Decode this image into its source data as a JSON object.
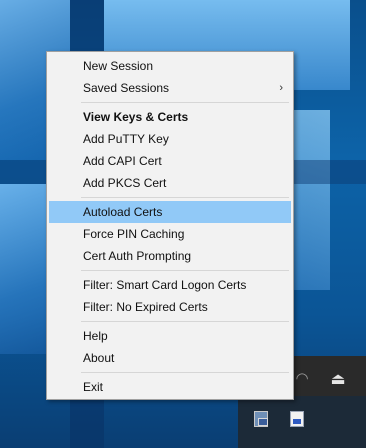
{
  "menu": {
    "groups": [
      [
        {
          "label": "New Session"
        },
        {
          "label": "Saved Sessions",
          "submenu_glyph": "›"
        }
      ],
      [
        {
          "label": "View Keys & Certs"
        },
        {
          "label": "Add PuTTY Key"
        },
        {
          "label": "Add CAPI Cert"
        },
        {
          "label": "Add PKCS Cert"
        }
      ],
      [
        {
          "label": "Autoload Certs"
        },
        {
          "label": "Force PIN Caching"
        },
        {
          "label": "Cert Auth Prompting"
        }
      ],
      [
        {
          "label": "Filter: Smart Card Logon Certs"
        },
        {
          "label": "Filter: No Expired Certs"
        }
      ],
      [
        {
          "label": "Help"
        },
        {
          "label": "About"
        }
      ],
      [
        {
          "label": "Exit"
        }
      ]
    ],
    "highlighted_item": "Autoload Certs",
    "default_item": "View Keys & Certs"
  },
  "tray": {
    "icons": [
      "wifi-icon",
      "usb-drive-icon",
      "pageant-icon",
      "certificate-icon"
    ]
  },
  "colors": {
    "menu_background": "#f2f2f2",
    "highlight": "#91c9f7",
    "desktop_blue": "#0d63a8"
  }
}
